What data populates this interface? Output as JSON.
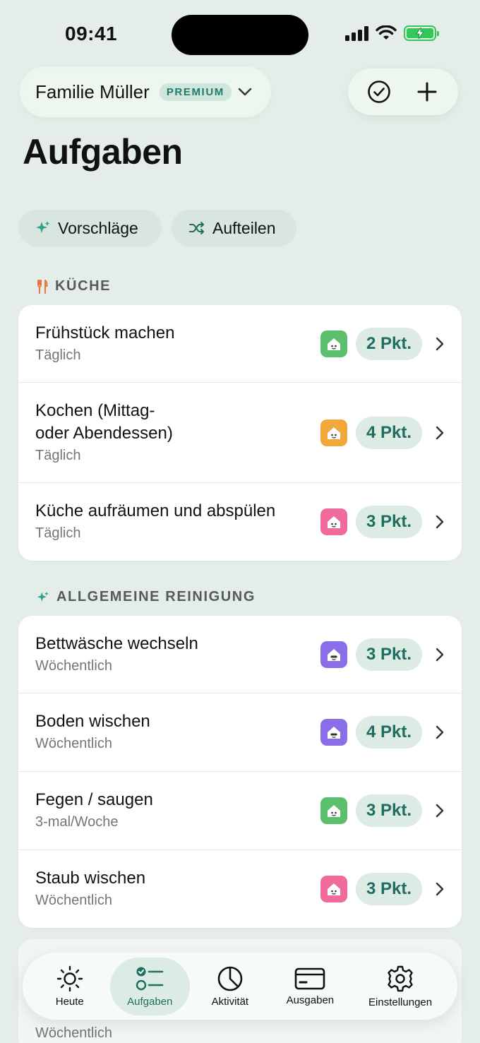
{
  "status_bar": {
    "time": "09:41"
  },
  "header": {
    "family_name": "Familie Müller",
    "badge": "PREMIUM",
    "title": "Aufgaben"
  },
  "chips": [
    {
      "label": "Vorschläge",
      "icon": "sparkle-icon"
    },
    {
      "label": "Aufteilen",
      "icon": "shuffle-icon"
    }
  ],
  "sections": [
    {
      "title": "KÜCHE",
      "icon": "fork-knife-icon",
      "tasks": [
        {
          "title": "Frühstück machen",
          "frequency": "Täglich",
          "avatar_color": "#5cbf6e",
          "points": "2 Pkt."
        },
        {
          "title": "Kochen (Mittag- oder Abendessen)",
          "frequency": "Täglich",
          "avatar_color": "#f2a73b",
          "points": "4 Pkt."
        },
        {
          "title": "Küche aufräumen und abspülen",
          "frequency": "Täglich",
          "avatar_color": "#f06a9b",
          "points": "3 Pkt."
        }
      ]
    },
    {
      "title": "ALLGEMEINE REINIGUNG",
      "icon": "sparkle-icon",
      "tasks": [
        {
          "title": "Bettwäsche wechseln",
          "frequency": "Wöchentlich",
          "avatar_color": "#8a6ee8",
          "points": "3 Pkt."
        },
        {
          "title": "Boden wischen",
          "frequency": "Wöchentlich",
          "avatar_color": "#8a6ee8",
          "points": "4 Pkt."
        },
        {
          "title": "Fegen / saugen",
          "frequency": "3-mal/Woche",
          "avatar_color": "#5cbf6e",
          "points": "3 Pkt."
        },
        {
          "title": "Staub wischen",
          "frequency": "Wöchentlich",
          "avatar_color": "#f06a9b",
          "points": "3 Pkt."
        }
      ]
    }
  ],
  "peek_row": {
    "frequency": "Wöchentlich"
  },
  "tab_bar": [
    {
      "label": "Heute",
      "icon": "sun-icon"
    },
    {
      "label": "Aufgaben",
      "icon": "checklist-icon",
      "active": true
    },
    {
      "label": "Aktivität",
      "icon": "pie-chart-icon"
    },
    {
      "label": "Ausgaben",
      "icon": "credit-card-icon"
    },
    {
      "label": "Einstellungen",
      "icon": "gear-icon"
    }
  ],
  "colors": {
    "accent": "#1f6e5f",
    "background": "#e5ede8",
    "points_bg": "#dcebe4"
  }
}
